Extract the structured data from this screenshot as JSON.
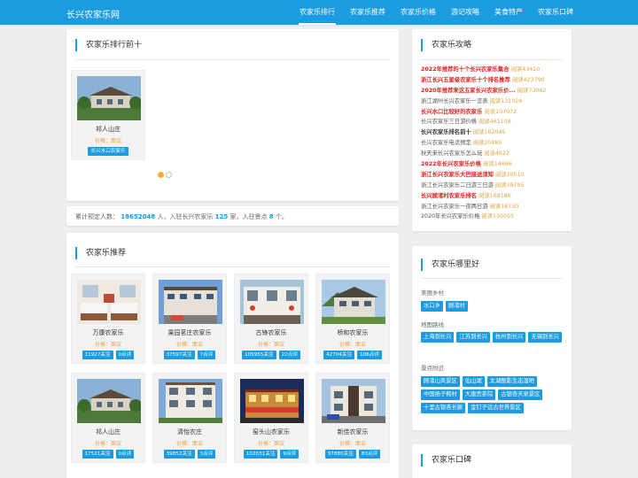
{
  "header": {
    "brand": "长兴农家乐网",
    "nav": [
      "农家乐排行",
      "农家乐推荐",
      "农家乐价格",
      "游记攻略",
      "美食特产",
      "农家乐口碑"
    ]
  },
  "ranking": {
    "title": "农家乐排行前十",
    "card": {
      "name": "祁人山庄",
      "price": "价格：面议",
      "tag": "长兴水口农家乐"
    }
  },
  "stats": {
    "prefix": "累计预定人数：",
    "people": "18652048",
    "mid1": "人，入驻长兴农家乐",
    "farms": "125",
    "mid2": "家，入驻景点",
    "spots": "8",
    "suffix": "个。"
  },
  "recommend": {
    "title": "农家乐推荐",
    "cards": [
      {
        "name": "万康农家乐",
        "price": "价格：面议",
        "follow": "11927关注",
        "reviews": "0点评"
      },
      {
        "name": "果园茗庄农家乐",
        "price": "价格：面议",
        "follow": "37597关注",
        "reviews": "7点评"
      },
      {
        "name": "古锋农家乐",
        "price": "价格：面议",
        "follow": "105955关注",
        "reviews": "22点评"
      },
      {
        "name": "桥和农家乐",
        "price": "价格：面议",
        "follow": "42704关注",
        "reviews": "106点评"
      },
      {
        "name": "祁人山庄",
        "price": "价格：面议",
        "follow": "17521关注",
        "reviews": "0点评"
      },
      {
        "name": "清怡农庄",
        "price": "价格：面议",
        "follow": "39852关注",
        "reviews": "3点评"
      },
      {
        "name": "窑头山农家乐",
        "price": "价格：面议",
        "follow": "102031关注",
        "reviews": "9点评"
      },
      {
        "name": "新佳农家乐",
        "price": "价格：面议",
        "follow": "97880关注",
        "reviews": "83点评"
      }
    ]
  },
  "guides": {
    "title": "农家乐攻略",
    "items": [
      {
        "text": "2022年推荐的十个长兴农家乐集合",
        "views": "阅读43420",
        "style": "red"
      },
      {
        "text": "浙江长兴五星级农家乐十个排名推荐",
        "views": "阅读423790",
        "style": "red"
      },
      {
        "text": "2020年推荐来这五家长兴农家乐价...",
        "views": "阅读73062",
        "style": "red"
      },
      {
        "text": "浙江湖州长兴农家乐一览表",
        "views": "阅读131024",
        "style": "normal"
      },
      {
        "text": "长兴水口比较好的农家乐",
        "views": "阅读107072",
        "style": "red"
      },
      {
        "text": "长兴农家乐三日游价格",
        "views": "阅读461109",
        "style": "normal"
      },
      {
        "text": "长兴农家乐排名前十",
        "views": "阅读162045",
        "style": "black"
      },
      {
        "text": "长兴农家乐电话预定",
        "views": "阅读20489",
        "style": "normal"
      },
      {
        "text": "秋天来长兴农家乐怎么玩",
        "views": "阅读4622",
        "style": "normal"
      },
      {
        "text": "2022年长兴农家乐价格",
        "views": "阅读14696",
        "style": "red"
      },
      {
        "text": "浙江长兴农家乐大巴接送须知",
        "views": "阅读20510",
        "style": "red"
      },
      {
        "text": "浙江长兴农家乐二日游三日游",
        "views": "阅读39795",
        "style": "normal"
      },
      {
        "text": "长兴顾渚村农家乐排名",
        "views": "阅读168186",
        "style": "red"
      },
      {
        "text": "浙江长兴农家乐一夜两日游",
        "views": "阅读18730",
        "style": "normal"
      },
      {
        "text": "2020年长兴农家乐价格",
        "views": "阅读130055",
        "style": "normal"
      }
    ]
  },
  "where": {
    "title": "农家乐哪里好",
    "groups": [
      {
        "label": "美丽乡村",
        "tags": [
          "水口乡",
          "顾渚村"
        ]
      },
      {
        "label": "地图路线",
        "tags": [
          "上海到长兴",
          "江苏到长兴",
          "杭州到长兴",
          "无锡到长兴"
        ]
      },
      {
        "label": "景点附近",
        "tags": [
          "顾渚山风景区",
          "仙山湖",
          "太湖图影生态湿地",
          "中国扬子鳄村",
          "大唐贡茶院",
          "古银杏天泉景区",
          "十里古银杏长廊",
          "金钉子远古世界景区"
        ]
      }
    ]
  },
  "reviews": {
    "title": "农家乐口碑"
  },
  "colors": {
    "accent": "#1b9be0",
    "price": "#e2a23a",
    "highlight": "#e11c1c"
  }
}
